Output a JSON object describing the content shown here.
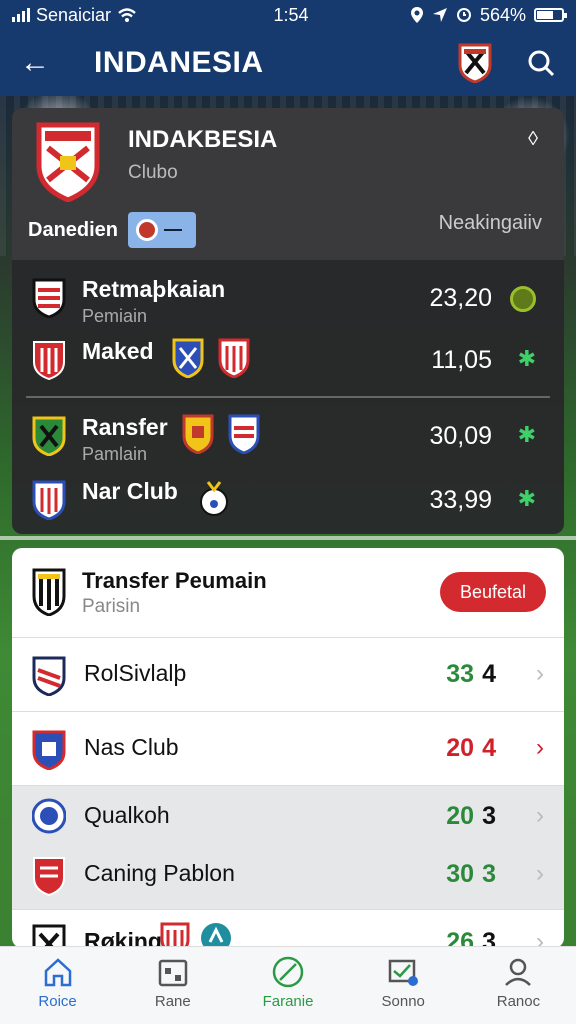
{
  "status_bar": {
    "carrier": "Senaiciar",
    "time": "1:54",
    "battery": "564%"
  },
  "app_bar": {
    "title": "INDANESIA"
  },
  "club_card": {
    "name": "INDAKBESIA",
    "subtitle": "Clubo",
    "left_label": "Danedien",
    "right_label": "Neakingaiiv",
    "rows": [
      {
        "name": "Retmaþkaian",
        "sub": "Pemiain",
        "value": "23,20"
      },
      {
        "name": "Maked",
        "sub": "",
        "value": "11,05"
      },
      {
        "name": "Ransfer",
        "sub": "Pamlain",
        "value": "30,09"
      },
      {
        "name": "Nar Club",
        "sub": "",
        "value": "33,99"
      }
    ]
  },
  "list_card": {
    "header": {
      "name": "Transfer Peumain",
      "sub": "Parisin",
      "button": "Beufetal"
    },
    "rows": [
      {
        "name": "RolSivlalþ",
        "a": "33",
        "b": "4"
      },
      {
        "name": "Nas Club",
        "a": "20",
        "b": "4"
      },
      {
        "name": "Qualkoh",
        "a": "20",
        "b": "3"
      },
      {
        "name": "Caning Pablon",
        "a": "30",
        "b": "3"
      },
      {
        "name": "Røking",
        "a": "26",
        "b": "3"
      }
    ]
  },
  "bottom_nav": [
    {
      "label": "Roice",
      "icon": "home-icon"
    },
    {
      "label": "Rane",
      "icon": "calendar-icon"
    },
    {
      "label": "Faranie",
      "icon": "ball-icon"
    },
    {
      "label": "Sonno",
      "icon": "messages-icon"
    },
    {
      "label": "Ranoc",
      "icon": "profile-icon"
    }
  ],
  "colors": {
    "app_bar": "#173a6e",
    "accent_red": "#d22a2f",
    "positive_green": "#2a8a3a",
    "nav_active": "#2b6dd1"
  }
}
